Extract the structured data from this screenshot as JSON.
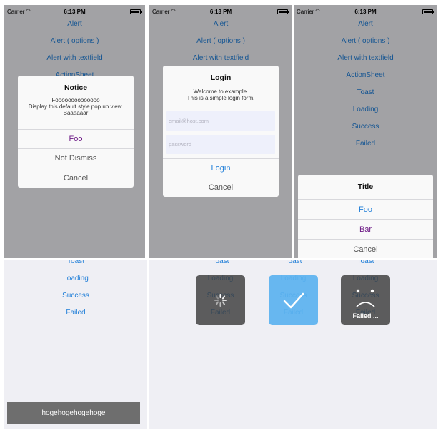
{
  "status_bar": {
    "carrier": "Carrier",
    "time": "6:13 PM"
  },
  "menu": {
    "alert": "Alert",
    "alert_options": "Alert ( options )",
    "alert_textfield": "Alert with textfield",
    "actionsheet": "ActionSheet",
    "toast": "Toast",
    "loading": "Loading",
    "success": "Success",
    "failed": "Failed"
  },
  "notice_alert": {
    "title": "Notice",
    "message_line1": "Foooooooooooooo",
    "message_line2": "Display this default style pop up view.",
    "message_line3": "Baaaaaar",
    "buttons": [
      "Foo",
      "Not Dismiss",
      "Cancel"
    ]
  },
  "login_alert": {
    "title": "Login",
    "message_line1": "Welcome to example.",
    "message_line2": "This is a simple login form.",
    "email_placeholder": "email@host.com",
    "password_placeholder": "password",
    "buttons": [
      "Login",
      "Cancel"
    ]
  },
  "action_sheet": {
    "title": "Title",
    "buttons": [
      "Foo",
      "Bar",
      "Cancel"
    ]
  },
  "toast": {
    "text": "hogehogehogehoge"
  },
  "huds": {
    "failed_text": "Failed ..."
  },
  "colors": {
    "link_blue": "#1f7ed8",
    "purple": "#6d1a86",
    "hud_dark": "#555555",
    "hud_success": "#5bb2ef",
    "background": "#efeff4"
  }
}
